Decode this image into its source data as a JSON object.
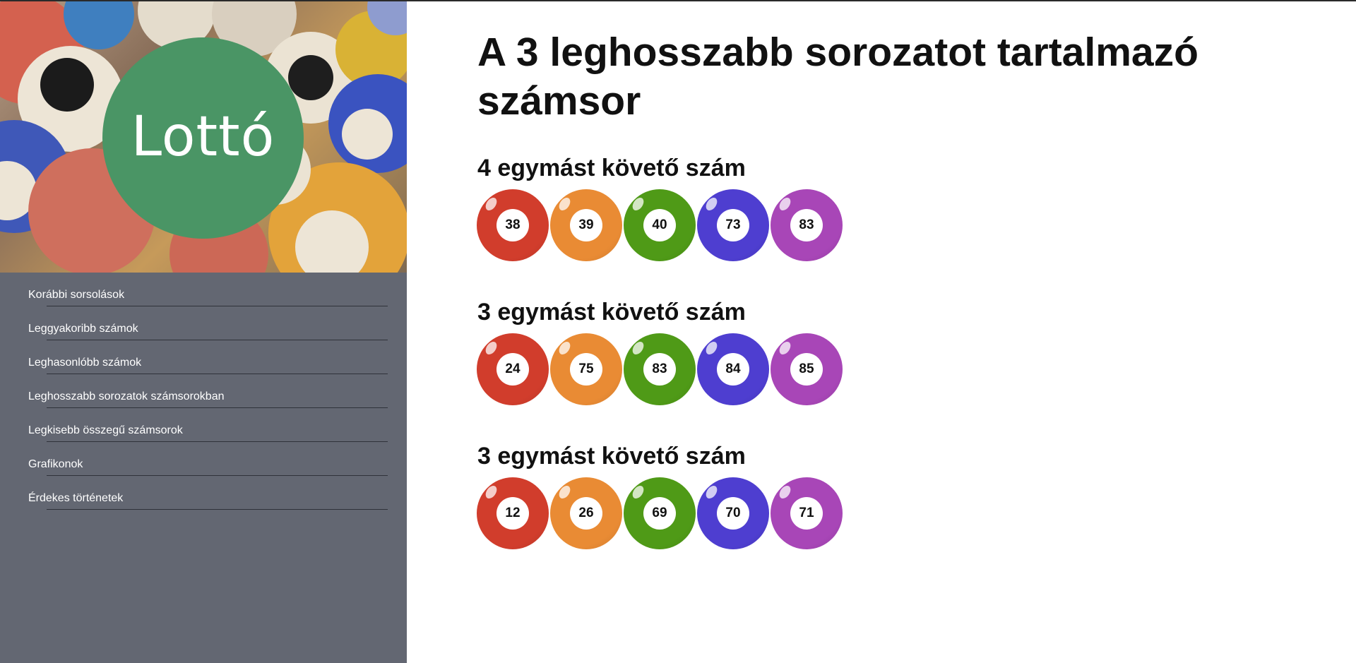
{
  "sidebar": {
    "logo_text": "Lottó",
    "nav": [
      {
        "label": "Korábbi sorsolások"
      },
      {
        "label": "Leggyakoribb számok"
      },
      {
        "label": "Leghasonlóbb számok"
      },
      {
        "label": "Leghosszabb sorozatok számsorokban"
      },
      {
        "label": "Legkisebb összegű számsorok"
      },
      {
        "label": "Grafikonok"
      },
      {
        "label": "Érdekes történetek"
      }
    ]
  },
  "main": {
    "title": "A 3 leghosszabb sorozatot tartalmazó számsor",
    "groups": [
      {
        "heading": "4 egymást követő szám",
        "numbers": [
          "38",
          "39",
          "40",
          "73",
          "83"
        ]
      },
      {
        "heading": "3 egymást követő szám",
        "numbers": [
          "24",
          "75",
          "83",
          "84",
          "85"
        ]
      },
      {
        "heading": "3 egymást követő szám",
        "numbers": [
          "12",
          "26",
          "69",
          "70",
          "71"
        ]
      }
    ]
  },
  "colors": {
    "ball_colors": [
      "#d13d2c",
      "#e98b34",
      "#4f9a17",
      "#4e3ed0",
      "#a846b7"
    ],
    "sidebar_bg": "#636772",
    "logo_green": "#4a9565"
  }
}
